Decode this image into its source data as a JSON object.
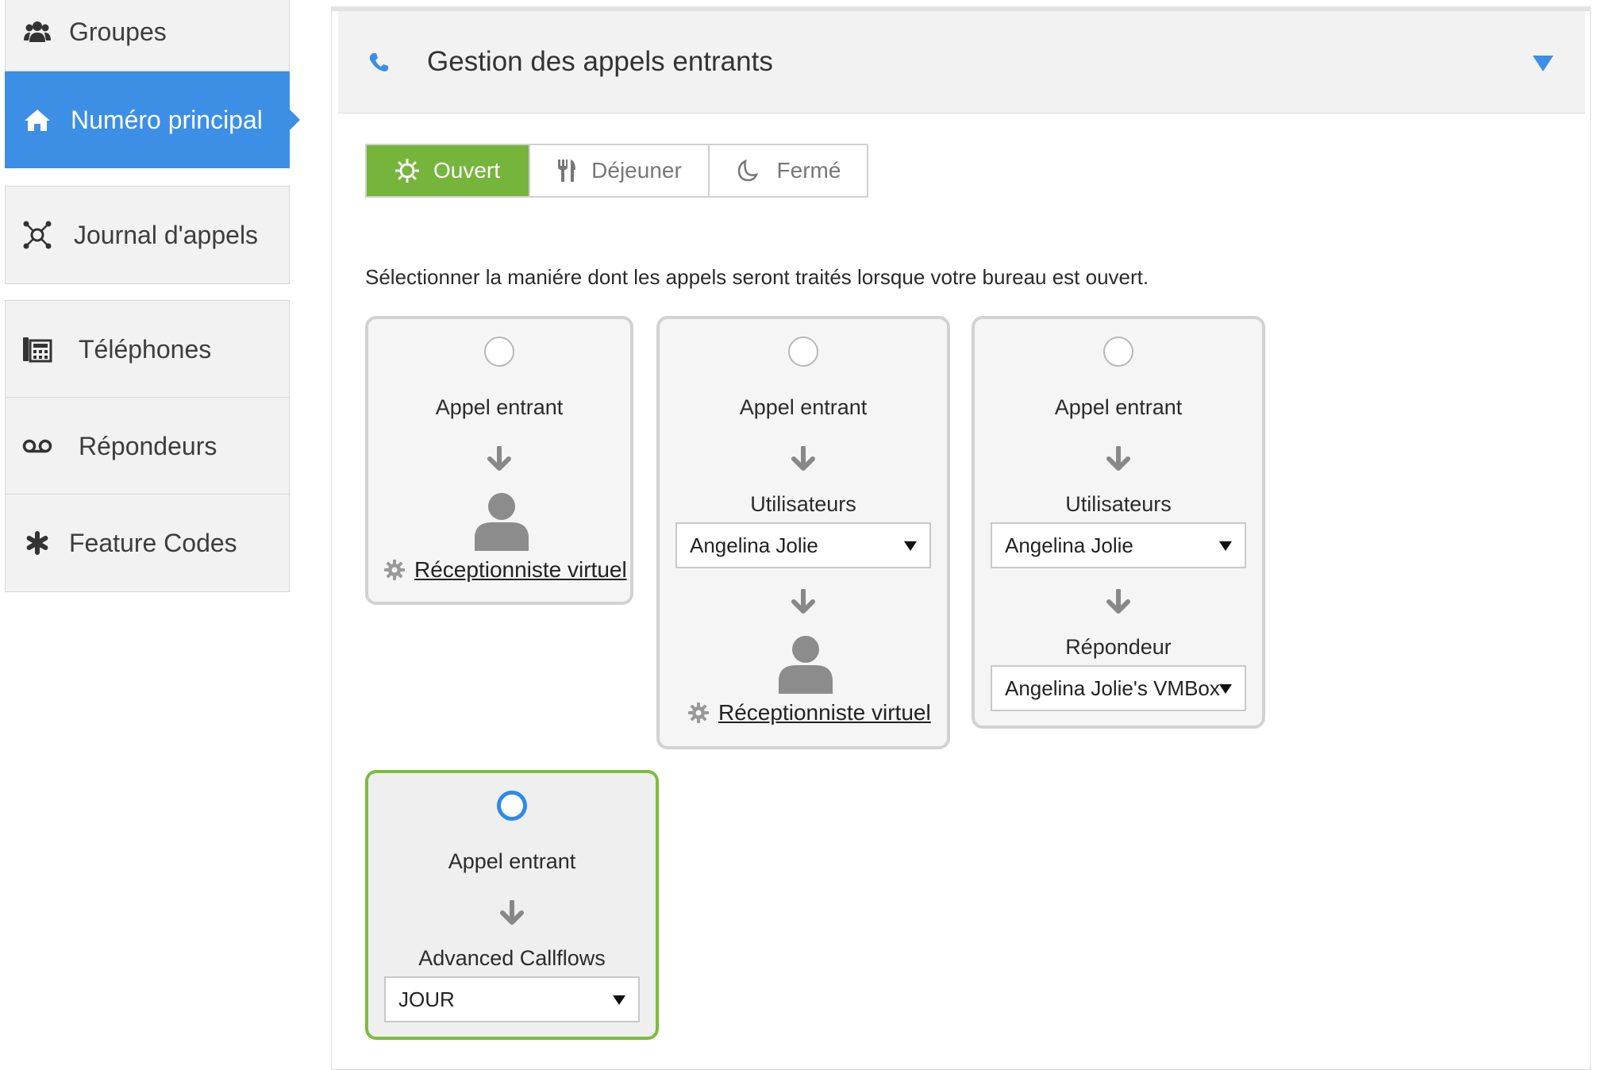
{
  "sidebar": {
    "items": [
      {
        "label": "Groupes",
        "icon": "users-icon"
      },
      {
        "label": "Numéro principal",
        "icon": "home-icon",
        "active": true
      },
      {
        "label": "Journal d'appels",
        "icon": "call-log-icon"
      },
      {
        "label": "Téléphones",
        "icon": "desk-phone-icon"
      },
      {
        "label": "Répondeurs",
        "icon": "voicemail-icon"
      },
      {
        "label": "Feature Codes",
        "icon": "asterisk-icon"
      }
    ]
  },
  "panel": {
    "title": "Gestion des appels entrants",
    "icon": "phone-icon"
  },
  "tabs": [
    {
      "label": "Ouvert",
      "icon": "sun-icon",
      "active": true
    },
    {
      "label": "Déjeuner",
      "icon": "utensils-icon"
    },
    {
      "label": "Fermé",
      "icon": "moon-icon"
    }
  ],
  "instruction": "Sélectionner la maniére dont les appels seront traités lorsque votre bureau est ouvert.",
  "options": [
    {
      "selected": false,
      "incoming": "Appel entrant",
      "link": "Réceptionniste virtuel"
    },
    {
      "selected": false,
      "incoming": "Appel entrant",
      "users_label": "Utilisateurs",
      "user_value": "Angelina Jolie",
      "link": "Réceptionniste virtuel"
    },
    {
      "selected": false,
      "incoming": "Appel entrant",
      "users_label": "Utilisateurs",
      "user_value": "Angelina Jolie",
      "vm_label": "Répondeur",
      "vm_value": "Angelina Jolie's VMBox"
    },
    {
      "selected": true,
      "incoming": "Appel entrant",
      "callflow_label": "Advanced Callflows",
      "callflow_value": "JOUR"
    }
  ],
  "colors": {
    "accent_blue": "#3d8fe6",
    "active_green": "#76b53c",
    "selected_border": "#7dbb3f"
  }
}
